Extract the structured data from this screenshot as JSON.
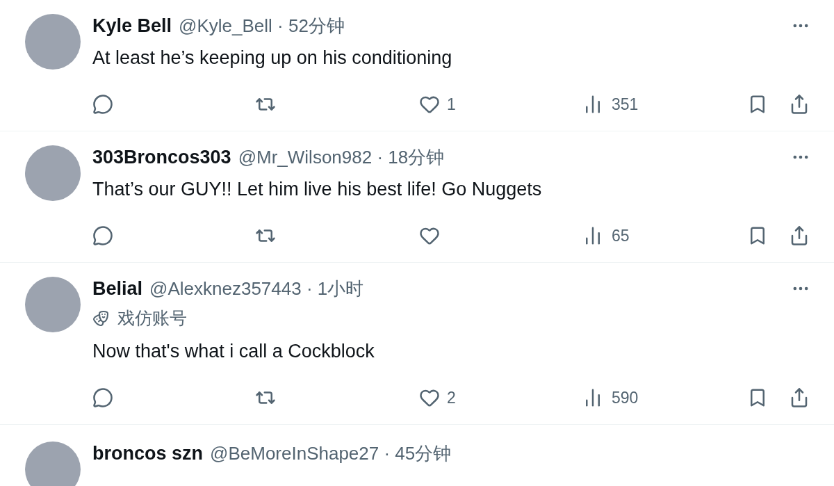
{
  "tweets": [
    {
      "name": "Kyle Bell",
      "meta": "@Kyle_Bell · 52分钟",
      "text": "At least he’s keeping up on his conditioning",
      "likes": "1",
      "views": "351"
    },
    {
      "name": "303Broncos303",
      "meta": "@Mr_Wilson982 · 18分钟",
      "text": "That’s our GUY!! Let him live his best life! Go Nuggets",
      "views": "65"
    },
    {
      "name": "Belial",
      "meta": "@Alexknez357443 · 1小时",
      "badge": "戏仿账号",
      "text": "Now that's what i call a Cockblock",
      "likes": "2",
      "views": "590"
    },
    {
      "name": "broncos szn",
      "meta": "@BeMoreInShape27 · 45分钟"
    }
  ]
}
